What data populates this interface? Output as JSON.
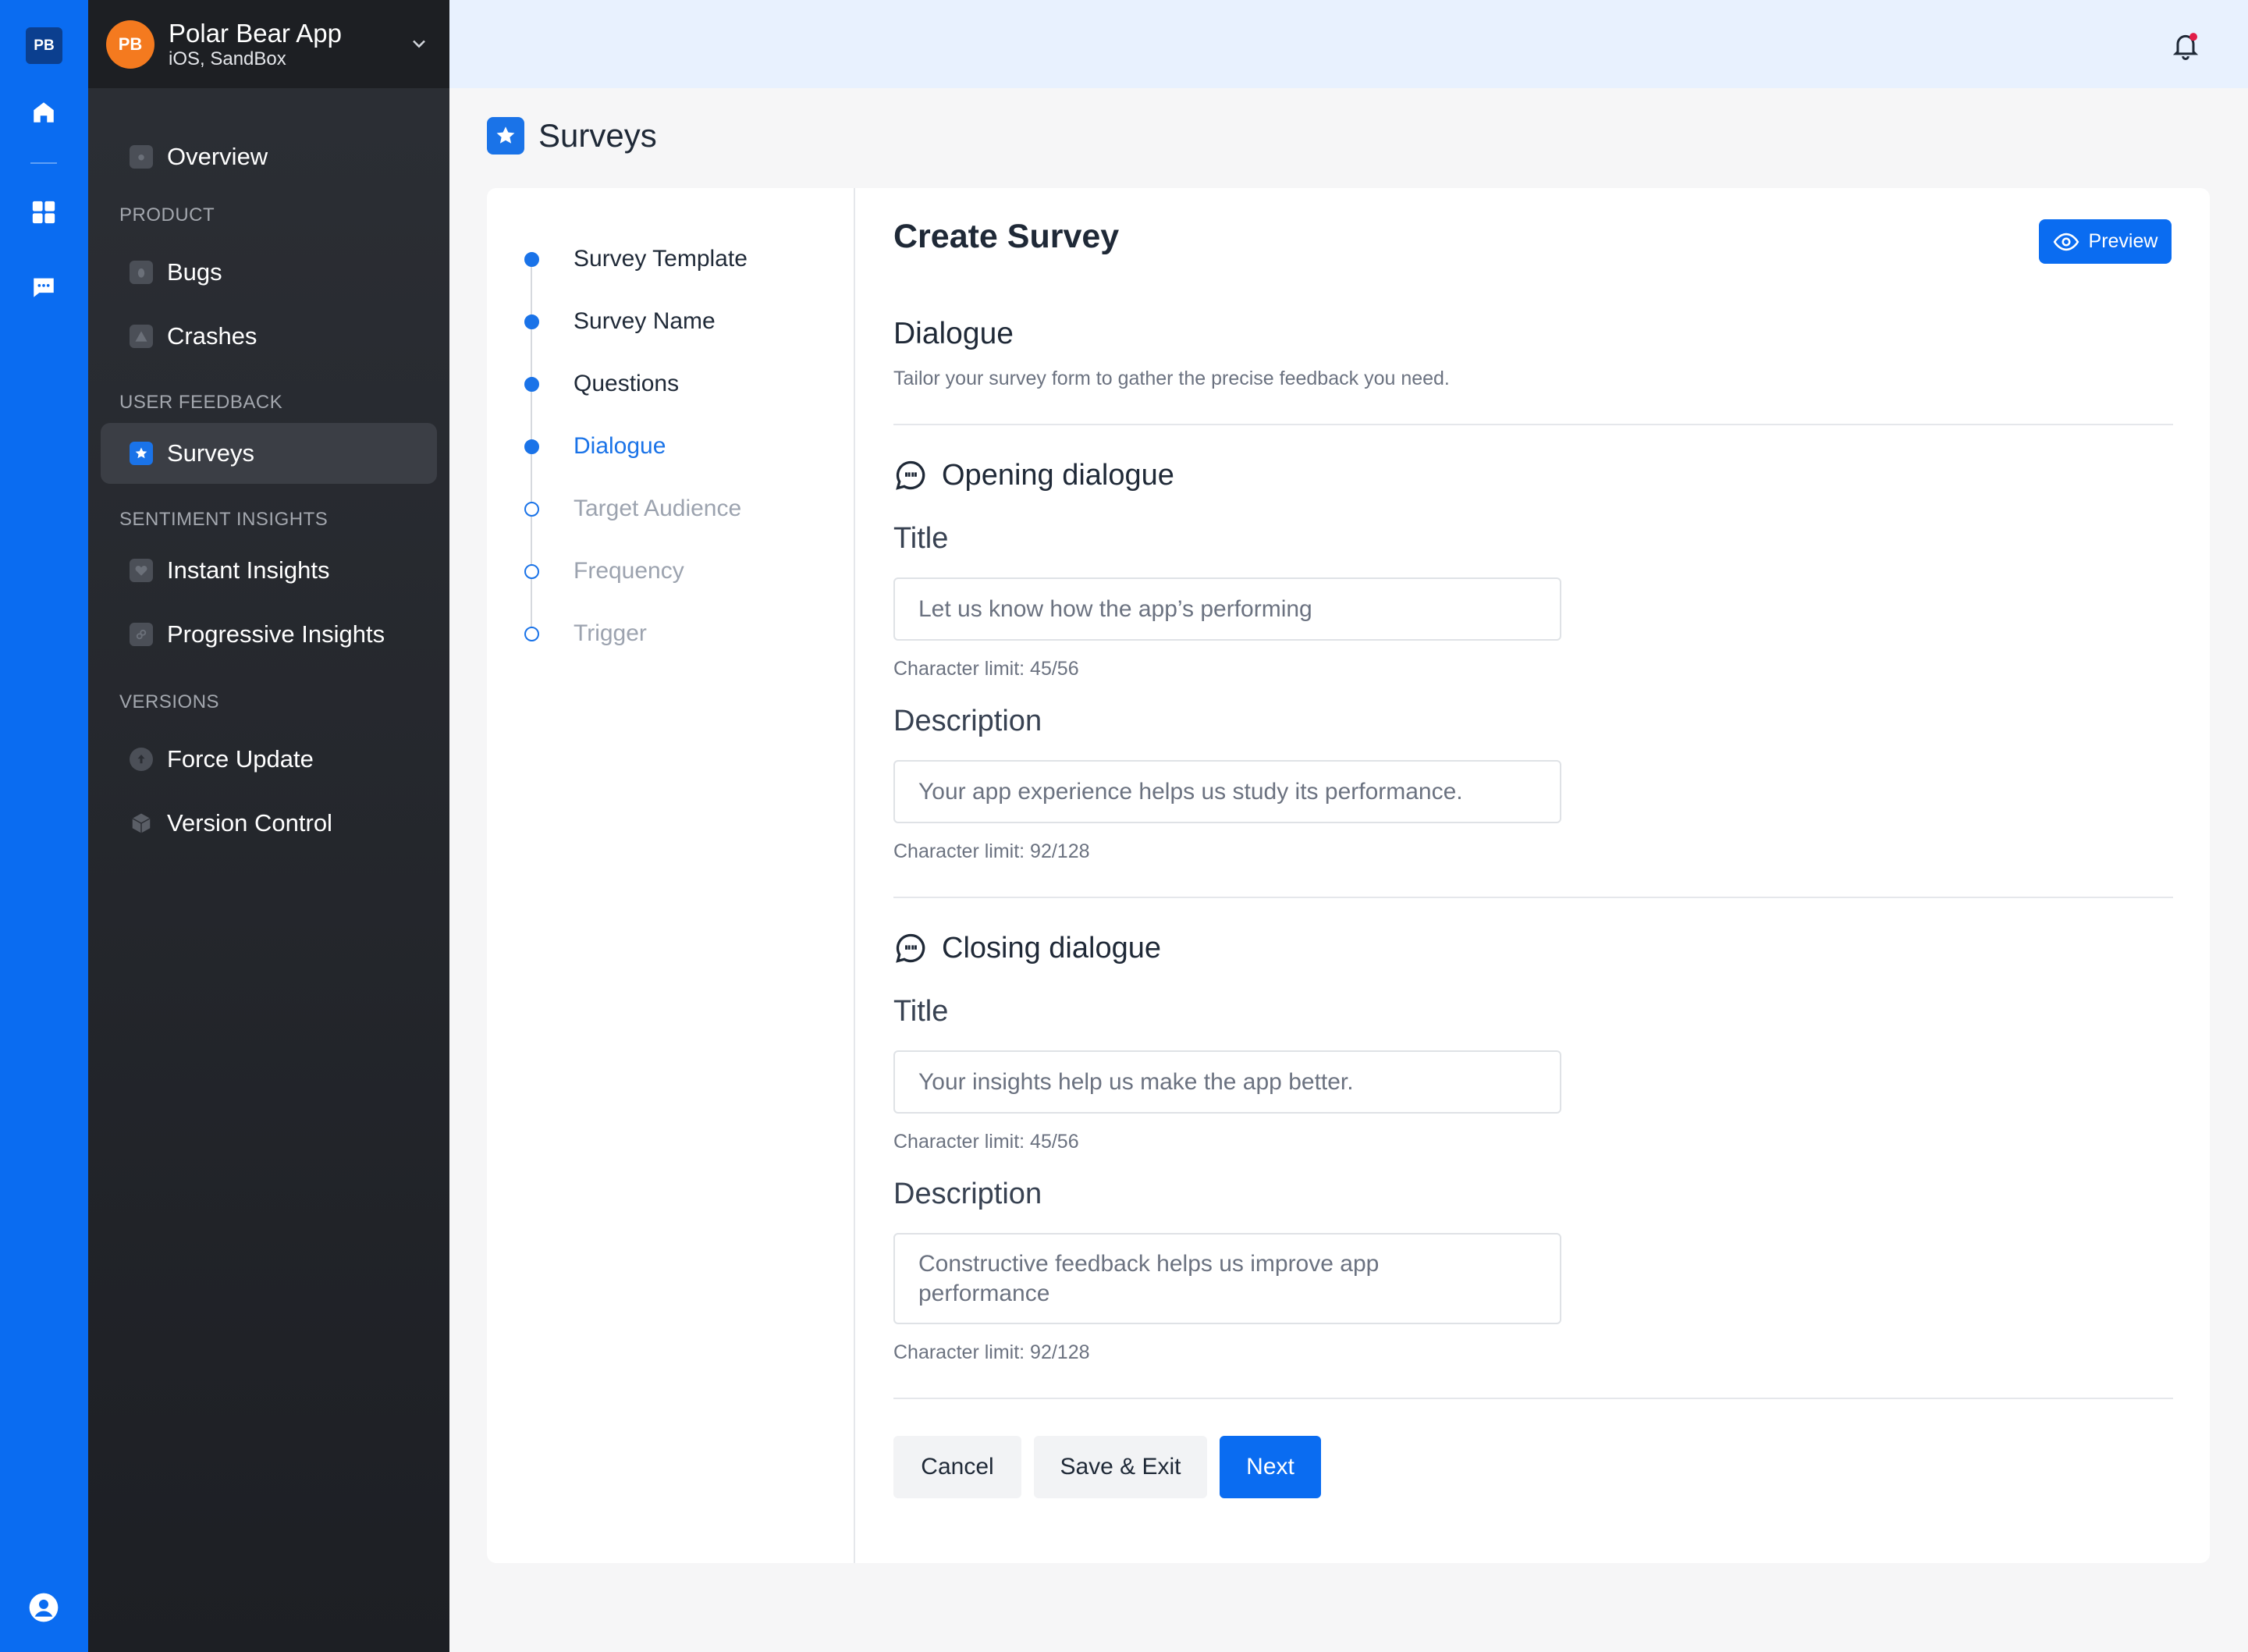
{
  "rail": {
    "logo": "PB"
  },
  "app": {
    "avatar": "PB",
    "name": "Polar Bear App",
    "platform": "iOS, SandBox"
  },
  "sidebar": {
    "overview": "Overview",
    "sections": {
      "product": "PRODUCT",
      "user_feedback": "USER FEEDBACK",
      "sentiment": "SENTIMENT INSIGHTS",
      "versions": "VERSIONS"
    },
    "items": {
      "bugs": "Bugs",
      "crashes": "Crashes",
      "surveys": "Surveys",
      "instant": "Instant Insights",
      "progressive": "Progressive Insights",
      "force_update": "Force Update",
      "version_control": "Version Control"
    },
    "active_item": "Surveys"
  },
  "page": {
    "title": "Surveys"
  },
  "steps": [
    {
      "label": "Survey Template",
      "state": "done"
    },
    {
      "label": "Survey Name",
      "state": "done"
    },
    {
      "label": "Questions",
      "state": "done"
    },
    {
      "label": "Dialogue",
      "state": "current"
    },
    {
      "label": "Target Audience",
      "state": "pending"
    },
    {
      "label": "Frequency",
      "state": "pending"
    },
    {
      "label": "Trigger",
      "state": "pending"
    }
  ],
  "form": {
    "title": "Create Survey",
    "preview_label": "Preview",
    "section_title": "Dialogue",
    "section_subtitle": "Tailor your survey form to gather the precise feedback you need.",
    "opening": {
      "heading": "Opening dialogue",
      "title_label": "Title",
      "title_value": "Let us know how the app’s performing",
      "title_limit": "Character limit: 45/56",
      "desc_label": "Description",
      "desc_value": "Your app experience helps us study its performance.",
      "desc_limit": "Character limit: 92/128"
    },
    "closing": {
      "heading": "Closing dialogue",
      "title_label": "Title",
      "title_value": "Your insights help us make the app better.",
      "title_limit": "Character limit: 45/56",
      "desc_label": "Description",
      "desc_value": "Constructive feedback helps us improve app performance",
      "desc_limit": "Character limit: 92/128"
    },
    "buttons": {
      "cancel": "Cancel",
      "save_exit": "Save & Exit",
      "next": "Next"
    }
  },
  "colors": {
    "accent": "#0a6cf1",
    "sidebar": "#25282d",
    "avatar": "#f47a1f",
    "notification_dot": "#e11d48"
  },
  "icons": [
    "home-icon",
    "grid-icon",
    "chat-icon",
    "user-circle-icon",
    "bell-icon",
    "chevron-down-icon",
    "star-icon",
    "eye-icon",
    "quote-bubble-icon"
  ]
}
